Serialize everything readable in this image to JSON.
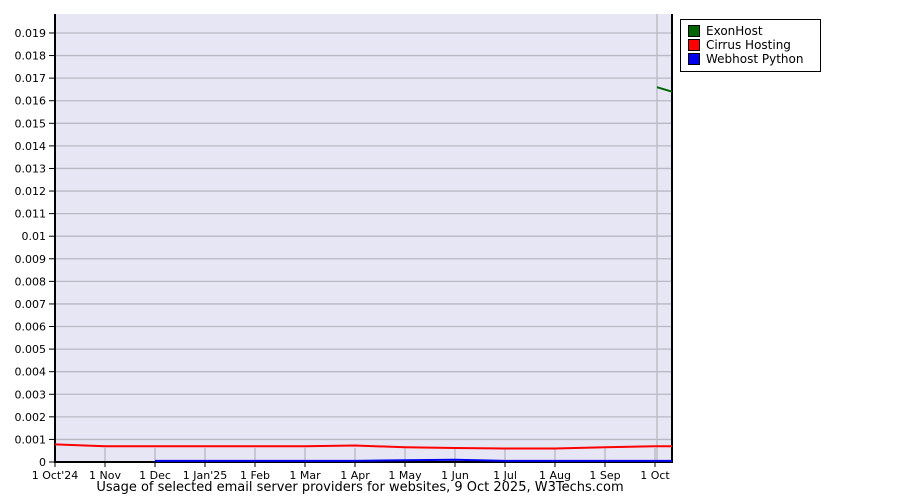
{
  "title": "Usage of selected email server providers for websites, 9 Oct 2025, W3Techs.com",
  "legend": {
    "items": [
      {
        "label": "ExonHost",
        "color": "#006400"
      },
      {
        "label": "Cirrus Hosting",
        "color": "#ff0000"
      },
      {
        "label": "Webhost Python",
        "color": "#0000ee"
      }
    ]
  },
  "chart_data": {
    "type": "line",
    "title": "Usage of selected email server providers for websites, 9 Oct 2025, W3Techs.com",
    "x_tick_labels": [
      "1 Oct'24",
      "1 Nov",
      "1 Dec",
      "1 Jan'25",
      "1 Feb",
      "1 Mar",
      "1 Apr",
      "1 May",
      "1 Jun",
      "1 Jul",
      "1 Aug",
      "1 Sep",
      "1 Oct"
    ],
    "y_tick_labels": [
      "0",
      "0.001",
      "0.002",
      "0.003",
      "0.004",
      "0.005",
      "0.006",
      "0.007",
      "0.008",
      "0.009",
      "0.01",
      "0.011",
      "0.012",
      "0.013",
      "0.014",
      "0.015",
      "0.016",
      "0.017",
      "0.018",
      "0.019"
    ],
    "y_tick_interval": 0.001,
    "ylim": [
      0,
      0.0198
    ],
    "grid": "horizontal",
    "legend_position": "top-right",
    "colors": {
      "plot_background": "#e6e6f5",
      "gridline": "#b9b9c4",
      "axis": "#000000"
    },
    "series": [
      {
        "name": "ExonHost",
        "color": "#006400",
        "points": [
          [
            12.04,
            0.0166
          ],
          [
            12.34,
            0.0164
          ]
        ]
      },
      {
        "name": "Cirrus Hosting",
        "color": "#ff0000",
        "points": [
          [
            0,
            0.00078
          ],
          [
            1,
            0.0007
          ],
          [
            2,
            0.0007
          ],
          [
            3,
            0.0007
          ],
          [
            4,
            0.0007
          ],
          [
            5,
            0.0007
          ],
          [
            6,
            0.00073
          ],
          [
            7,
            0.00065
          ],
          [
            8,
            0.00062
          ],
          [
            9,
            0.0006
          ],
          [
            10,
            0.0006
          ],
          [
            11,
            0.00065
          ],
          [
            12,
            0.0007
          ],
          [
            12.34,
            0.0007
          ]
        ]
      },
      {
        "name": "Webhost Python",
        "color": "#0000ee",
        "points": [
          [
            2,
            5e-05
          ],
          [
            3,
            5e-05
          ],
          [
            4,
            5e-05
          ],
          [
            5,
            5e-05
          ],
          [
            6,
            5e-05
          ],
          [
            7,
            8e-05
          ],
          [
            8,
            0.0001
          ],
          [
            9,
            5e-05
          ],
          [
            10,
            5e-05
          ],
          [
            11,
            5e-05
          ],
          [
            12,
            5e-05
          ],
          [
            12.34,
            5e-05
          ]
        ]
      }
    ]
  }
}
